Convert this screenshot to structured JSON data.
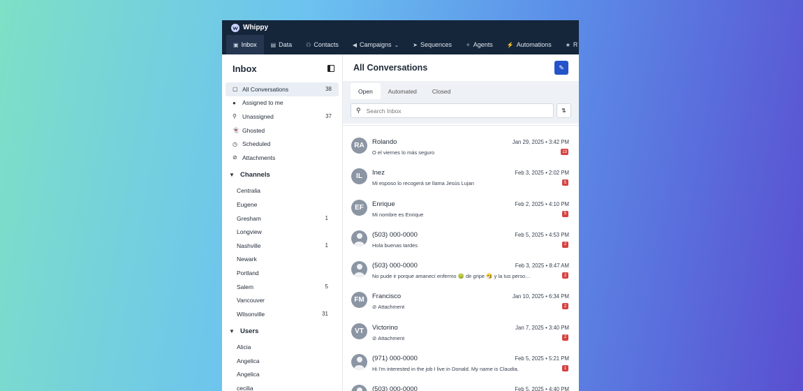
{
  "app": {
    "name": "Whippy"
  },
  "nav": [
    {
      "label": "Inbox",
      "icon": "inbox-icon",
      "glyph": "▣",
      "active": true
    },
    {
      "label": "Data",
      "icon": "data-icon",
      "glyph": "▤",
      "active": false
    },
    {
      "label": "Contacts",
      "icon": "contacts-icon",
      "glyph": "⚇",
      "active": false
    },
    {
      "label": "Campaigns",
      "icon": "campaigns-icon",
      "glyph": "◀",
      "active": false,
      "dropdown": true
    },
    {
      "label": "Sequences",
      "icon": "sequences-icon",
      "glyph": "➤",
      "active": false
    },
    {
      "label": "Agents",
      "icon": "agents-icon",
      "glyph": "✧",
      "active": false
    },
    {
      "label": "Automations",
      "icon": "automations-icon",
      "glyph": "⚡",
      "active": false
    },
    {
      "label": "R",
      "icon": "reviews-icon",
      "glyph": "★",
      "active": false
    }
  ],
  "sidebar": {
    "title": "Inbox",
    "items": [
      {
        "label": "All Conversations",
        "count": "38",
        "icon": "conversations-icon",
        "glyph": "▢",
        "active": true
      },
      {
        "label": "Assigned to me",
        "count": "",
        "icon": "user-circle-icon",
        "glyph": "●",
        "active": false
      },
      {
        "label": "Unassigned",
        "count": "37",
        "icon": "user-minus-icon",
        "glyph": "⚲",
        "active": false
      },
      {
        "label": "Ghosted",
        "count": "",
        "icon": "ghost-icon",
        "glyph": "👻",
        "active": false
      },
      {
        "label": "Scheduled",
        "count": "",
        "icon": "clock-icon",
        "glyph": "◷",
        "active": false
      },
      {
        "label": "Attachments",
        "count": "",
        "icon": "paperclip-icon",
        "glyph": "⊘",
        "active": false
      }
    ],
    "channels_title": "Channels",
    "channels": [
      {
        "label": "Centralia",
        "count": ""
      },
      {
        "label": "Eugene",
        "count": ""
      },
      {
        "label": "Gresham",
        "count": "1"
      },
      {
        "label": "Longview",
        "count": ""
      },
      {
        "label": "Nashville",
        "count": "1"
      },
      {
        "label": "Newark",
        "count": ""
      },
      {
        "label": "Portland",
        "count": ""
      },
      {
        "label": "Salem",
        "count": "5"
      },
      {
        "label": "Vancouver",
        "count": ""
      },
      {
        "label": "Wilsonville",
        "count": "31"
      }
    ],
    "users_title": "Users",
    "users": [
      {
        "label": "Alicia"
      },
      {
        "label": "Angelica"
      },
      {
        "label": "Angelica"
      },
      {
        "label": "cecilia"
      }
    ]
  },
  "main": {
    "title": "All Conversations",
    "tabs": [
      {
        "label": "Open",
        "active": true
      },
      {
        "label": "Automated",
        "active": false
      },
      {
        "label": "Closed",
        "active": false
      }
    ],
    "search": {
      "placeholder": "Search Inbox",
      "value": ""
    },
    "badge_color": "#d64242",
    "conversations": [
      {
        "name": "Rolando",
        "initials": "RA",
        "preview": "O el viernes lo más seguro",
        "attachment": false,
        "date": "Jan 29, 2025 • 3:42 PM",
        "unread": "13"
      },
      {
        "name": "Inez",
        "initials": "IL",
        "preview": "Mi esposo lo recogerá se llama Jesús Lujan",
        "attachment": false,
        "date": "Feb 3, 2025 • 2:02 PM",
        "unread": "5"
      },
      {
        "name": "Enrique",
        "initials": "EF",
        "preview": "Mi nombre es Enrique",
        "attachment": false,
        "date": "Feb 2, 2025 • 4:10 PM",
        "unread": "5"
      },
      {
        "name": "(503) 000-0000",
        "initials": "",
        "preview": "Hola buenas tardes",
        "attachment": false,
        "date": "Feb 5, 2025 • 4:53 PM",
        "unread": "2"
      },
      {
        "name": "(503) 000-0000",
        "initials": "",
        "preview": "No pude ir porque amanecí enfermo 🤢 de gripe 🤧 y la tus personas",
        "attachment": false,
        "date": "Feb 3, 2025 • 8:47 AM",
        "unread": "2"
      },
      {
        "name": "Francisco",
        "initials": "FM",
        "preview": "Attachment",
        "attachment": true,
        "date": "Jan 10, 2025 • 6:34 PM",
        "unread": "2"
      },
      {
        "name": "Victorino",
        "initials": "VT",
        "preview": "Attachment",
        "attachment": true,
        "date": "Jan 7, 2025 • 3:40 PM",
        "unread": "2"
      },
      {
        "name": "(971) 000-0000",
        "initials": "",
        "preview": "Hi I'm interested in the job I live in Donald. My name is Claudia.",
        "attachment": false,
        "date": "Feb 5, 2025 • 5:21 PM",
        "unread": "1"
      },
      {
        "name": "(503) 000-0000",
        "initials": "",
        "preview": "",
        "attachment": false,
        "date": "Feb 5, 2025 • 4:40 PM",
        "unread": ""
      }
    ]
  }
}
